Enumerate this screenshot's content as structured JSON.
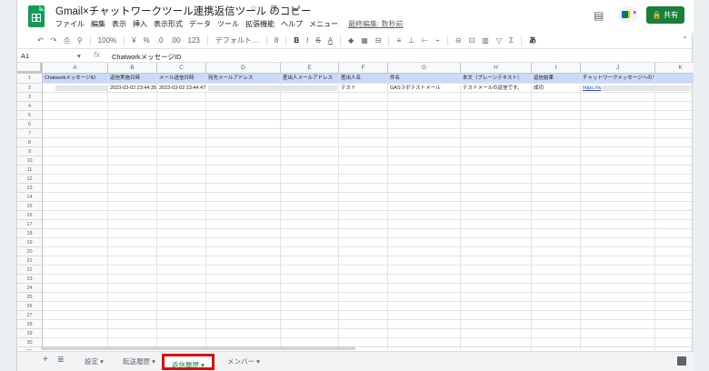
{
  "app": {
    "doc_title": "Gmail×チャットワークツール連携返信ツール のコピー",
    "title_icons": "☆ ⊡ ☁",
    "menus": [
      "ファイル",
      "編集",
      "表示",
      "挿入",
      "表示形式",
      "データ",
      "ツール",
      "拡張機能",
      "ヘルプ",
      "メニュー"
    ],
    "last_edit": "最終編集: 数秒前",
    "share_label": "共有"
  },
  "toolbar": {
    "undo": "↶",
    "redo": "↷",
    "print": "⎙",
    "paint": "⚲",
    "zoom": "100%",
    "currency": "¥",
    "percent": "%",
    "dec_less": ".0",
    "dec_more": ".00",
    "format_123": "123",
    "font": "デフォルト…",
    "font_size": "8",
    "bold": "B",
    "italic": "I",
    "strike": "S",
    "text_color": "A",
    "fill": "◆",
    "borders": "▦",
    "merge": "⊟",
    "align": "≡",
    "valign": "⊥",
    "wrap": "⊢",
    "rotate": "⌁",
    "link": "⊝",
    "comment": "⊡",
    "chart": "▥",
    "filter": "▽",
    "functions": "Σ",
    "input_tools": "あ",
    "collapse": "⌃"
  },
  "formula": {
    "cell_ref": "A1",
    "value": "ChatworkメッセージID"
  },
  "columns": [
    "A",
    "B",
    "C",
    "D",
    "E",
    "F",
    "G",
    "H",
    "I",
    "J",
    "K"
  ],
  "header_row": [
    "ChatworkメッセージID",
    "返信実施日時",
    "メール送信日時",
    "宛先メールアドレス",
    "差出人メールアドレス",
    "差出人名",
    "件名",
    "本文（プレーンテキスト）",
    "返信結果",
    "チャットワークメッセージへのリンク",
    ""
  ],
  "data_row": [
    "",
    "2023-03-02 23:44:35",
    "2023-03-02 23:44:47",
    "",
    "",
    "テスト",
    "GASラボテストメール",
    "テストメールの返信です。",
    "成功",
    "https://w",
    ""
  ],
  "row_numbers": [
    "1",
    "2",
    "3",
    "4",
    "5",
    "6",
    "7",
    "8",
    "9",
    "10",
    "11",
    "12",
    "13",
    "14",
    "15",
    "16",
    "17",
    "18",
    "19",
    "20",
    "21",
    "22",
    "23",
    "24",
    "25",
    "26",
    "27",
    "28",
    "29",
    "30",
    "31"
  ],
  "tabs": {
    "add": "+",
    "list": "≣",
    "settings": "設定",
    "forward": "転送履歴",
    "reply": "返信履歴",
    "members": "メンバー"
  },
  "colors": {
    "header_fill": "#c9daf8",
    "active_tab": "#188038",
    "highlight": "#e10b0b",
    "share": "#188038"
  }
}
